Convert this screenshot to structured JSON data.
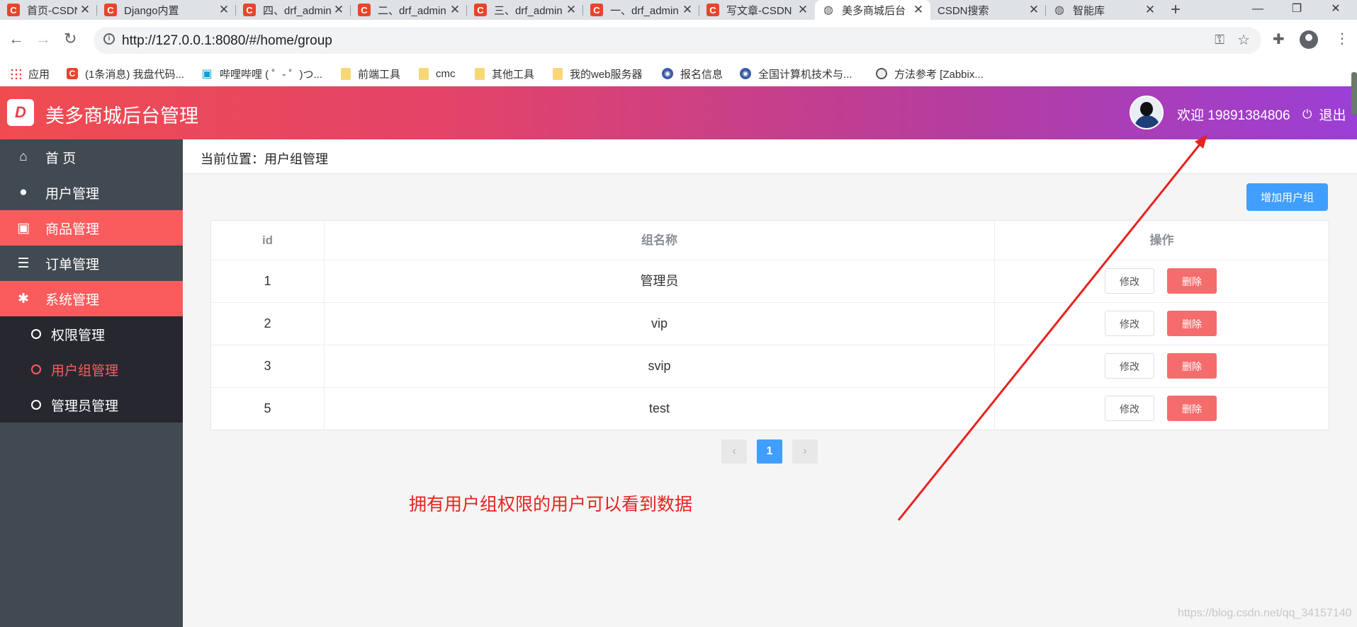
{
  "browser": {
    "tabs": [
      {
        "label": "首页-CSDN博客",
        "icon": "csdn-icon"
      },
      {
        "label": "Django内置",
        "icon": "csdn-icon"
      },
      {
        "label": "四、drf_admin",
        "icon": "csdn-icon"
      },
      {
        "label": "二、drf_admin",
        "icon": "csdn-icon"
      },
      {
        "label": "三、drf_admin",
        "icon": "csdn-icon"
      },
      {
        "label": "一、drf_admin",
        "icon": "csdn-icon"
      },
      {
        "label": "写文章-CSDN",
        "icon": "csdn-icon"
      },
      {
        "label": "美多商城后台",
        "icon": "globe-icon"
      },
      {
        "label": "CSDN搜索",
        "icon": ""
      },
      {
        "label": "智能库",
        "icon": "globe-icon"
      }
    ],
    "close_glyph": "✕",
    "new_tab_glyph": "+",
    "window": {
      "minimize": "—",
      "maximize": "❐",
      "close": "✕"
    },
    "url": "http://127.0.0.1:8080/#/home/group",
    "bookmarks": [
      {
        "label": "应用",
        "icon": "apps-icon"
      },
      {
        "label": "(1条消息) 我盘代码...",
        "icon": "csdn-icon"
      },
      {
        "label": "哔哩哔哩 ( ゜- ゜)つ...",
        "icon": "bilibili-icon"
      },
      {
        "label": "前端工具",
        "icon": "folder-icon"
      },
      {
        "label": "cmc",
        "icon": "folder-icon"
      },
      {
        "label": "其他工具",
        "icon": "folder-icon"
      },
      {
        "label": "我的web服务器",
        "icon": "folder-icon"
      },
      {
        "label": "报名信息",
        "icon": "site-icon"
      },
      {
        "label": "全国计算机技术与...",
        "icon": "site-icon"
      },
      {
        "label": "方法参考 [Zabbix...",
        "icon": "globe-icon"
      }
    ]
  },
  "app": {
    "logo_text": "D",
    "title": "美多商城后台管理",
    "welcome": "欢迎 19891384806",
    "logout_label": "退出",
    "colors": {
      "header_start": "#f04c50",
      "header_end": "#9b3fd6",
      "accent": "#fa5c5e",
      "primary": "#409eff",
      "danger": "#f56c6c"
    }
  },
  "sidebar": {
    "items": [
      {
        "label": "首 页",
        "icon": "home-icon",
        "glyph": "⌂"
      },
      {
        "label": "用户管理",
        "icon": "user-icon",
        "glyph": "●"
      },
      {
        "label": "商品管理",
        "icon": "basket-icon",
        "glyph": "▣"
      },
      {
        "label": "订单管理",
        "icon": "list-icon",
        "glyph": "☰"
      },
      {
        "label": "系统管理",
        "icon": "gear-icon",
        "glyph": "✱"
      }
    ],
    "subitems": [
      {
        "label": "权限管理"
      },
      {
        "label": "用户组管理"
      },
      {
        "label": "管理员管理"
      }
    ]
  },
  "main": {
    "breadcrumb": "当前位置：用户组管理",
    "add_button": "增加用户组",
    "table": {
      "headers": [
        "id",
        "组名称",
        "操作"
      ],
      "rows": [
        {
          "id": "1",
          "name": "管理员"
        },
        {
          "id": "2",
          "name": "vip"
        },
        {
          "id": "3",
          "name": "svip"
        },
        {
          "id": "5",
          "name": "test"
        }
      ],
      "edit_label": "修改",
      "delete_label": "删除"
    },
    "pagination": {
      "prev": "‹",
      "current": "1",
      "next": "›"
    }
  },
  "annotation": "拥有用户组权限的用户可以看到数据",
  "watermark": "https://blog.csdn.net/qq_34157140"
}
